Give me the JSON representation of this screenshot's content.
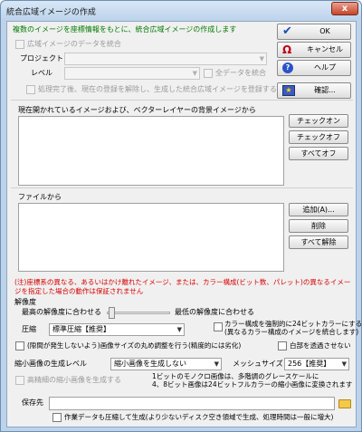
{
  "window": {
    "title": "統合広域イメージの作成",
    "close_glyph": "x"
  },
  "intro_text": "複数のイメージを座標情報をもとに、統合広域イメージの作成します",
  "integrate": {
    "checkbox_label": "広域イメージのデータを統合",
    "project_label": "プロジェクト",
    "level_label": "レベル",
    "all_data_label": "全データを統合",
    "release_label": "処理完了後、現在の登録を解除し、生成した統合広域イメージを登録する"
  },
  "buttons": {
    "ok": "OK",
    "cancel": "キャンセル",
    "help": "ヘルプ",
    "confirm": "確認..."
  },
  "open_images": {
    "label": "現在開かれているイメージおよび、ベクターレイヤーの背景イメージから",
    "check_on": "チェックオン",
    "check_off": "チェックオフ",
    "all_off": "すべてオフ"
  },
  "files": {
    "label": "ファイルから",
    "add": "追加(A)...",
    "remove": "削除",
    "remove_all": "すべて解除"
  },
  "note": "(注)座標系の異なる、あるいはかけ離れたイメージ、または、カラー構成(ビット数、パレット)の異なるイメージを指定した場合の動作は保証されません",
  "resolution": {
    "title": "解像度",
    "max_label": "最高の解像度に合わせる",
    "min_label": "最低の解像度に合わせる"
  },
  "compression": {
    "label": "圧縮",
    "value": "標準圧縮【推奨】",
    "force24_line1": "カラー構成を強制的に24ビットカラーにする",
    "force24_line2": "(異なるカラー構成のイメージを統合します)",
    "rounding_label": "(隙間が発生しないよう)画像サイズの丸め調整を行う(精度的には劣化)",
    "white_transparent_label": "白部を透過させない"
  },
  "thumbnail": {
    "level_label": "縮小画像の生成レベル",
    "level_value": "縮小画像を生成しない",
    "mesh_label": "メッシュサイズ",
    "mesh_value": "256【推奨】",
    "hq_label": "高精細の縮小画像を生成する",
    "info_line1": "1ビットのモノクロ画像は、多階調のグレースケールに",
    "info_line2": "4、8ビット画像は24ビットフルカラーの縮小画像に変換されます"
  },
  "save": {
    "label": "保存先",
    "value": "",
    "compress_work_label": "作業データも圧縮して生成(より少ないディスク空き領域で生成、処理時間は一般に増大)"
  },
  "colors": {
    "intro": "#007a00",
    "note": "#d80000",
    "ok_check": "#1a4fb8",
    "cancel_icon": "#c0001a",
    "help_icon": "#2a52c8"
  }
}
